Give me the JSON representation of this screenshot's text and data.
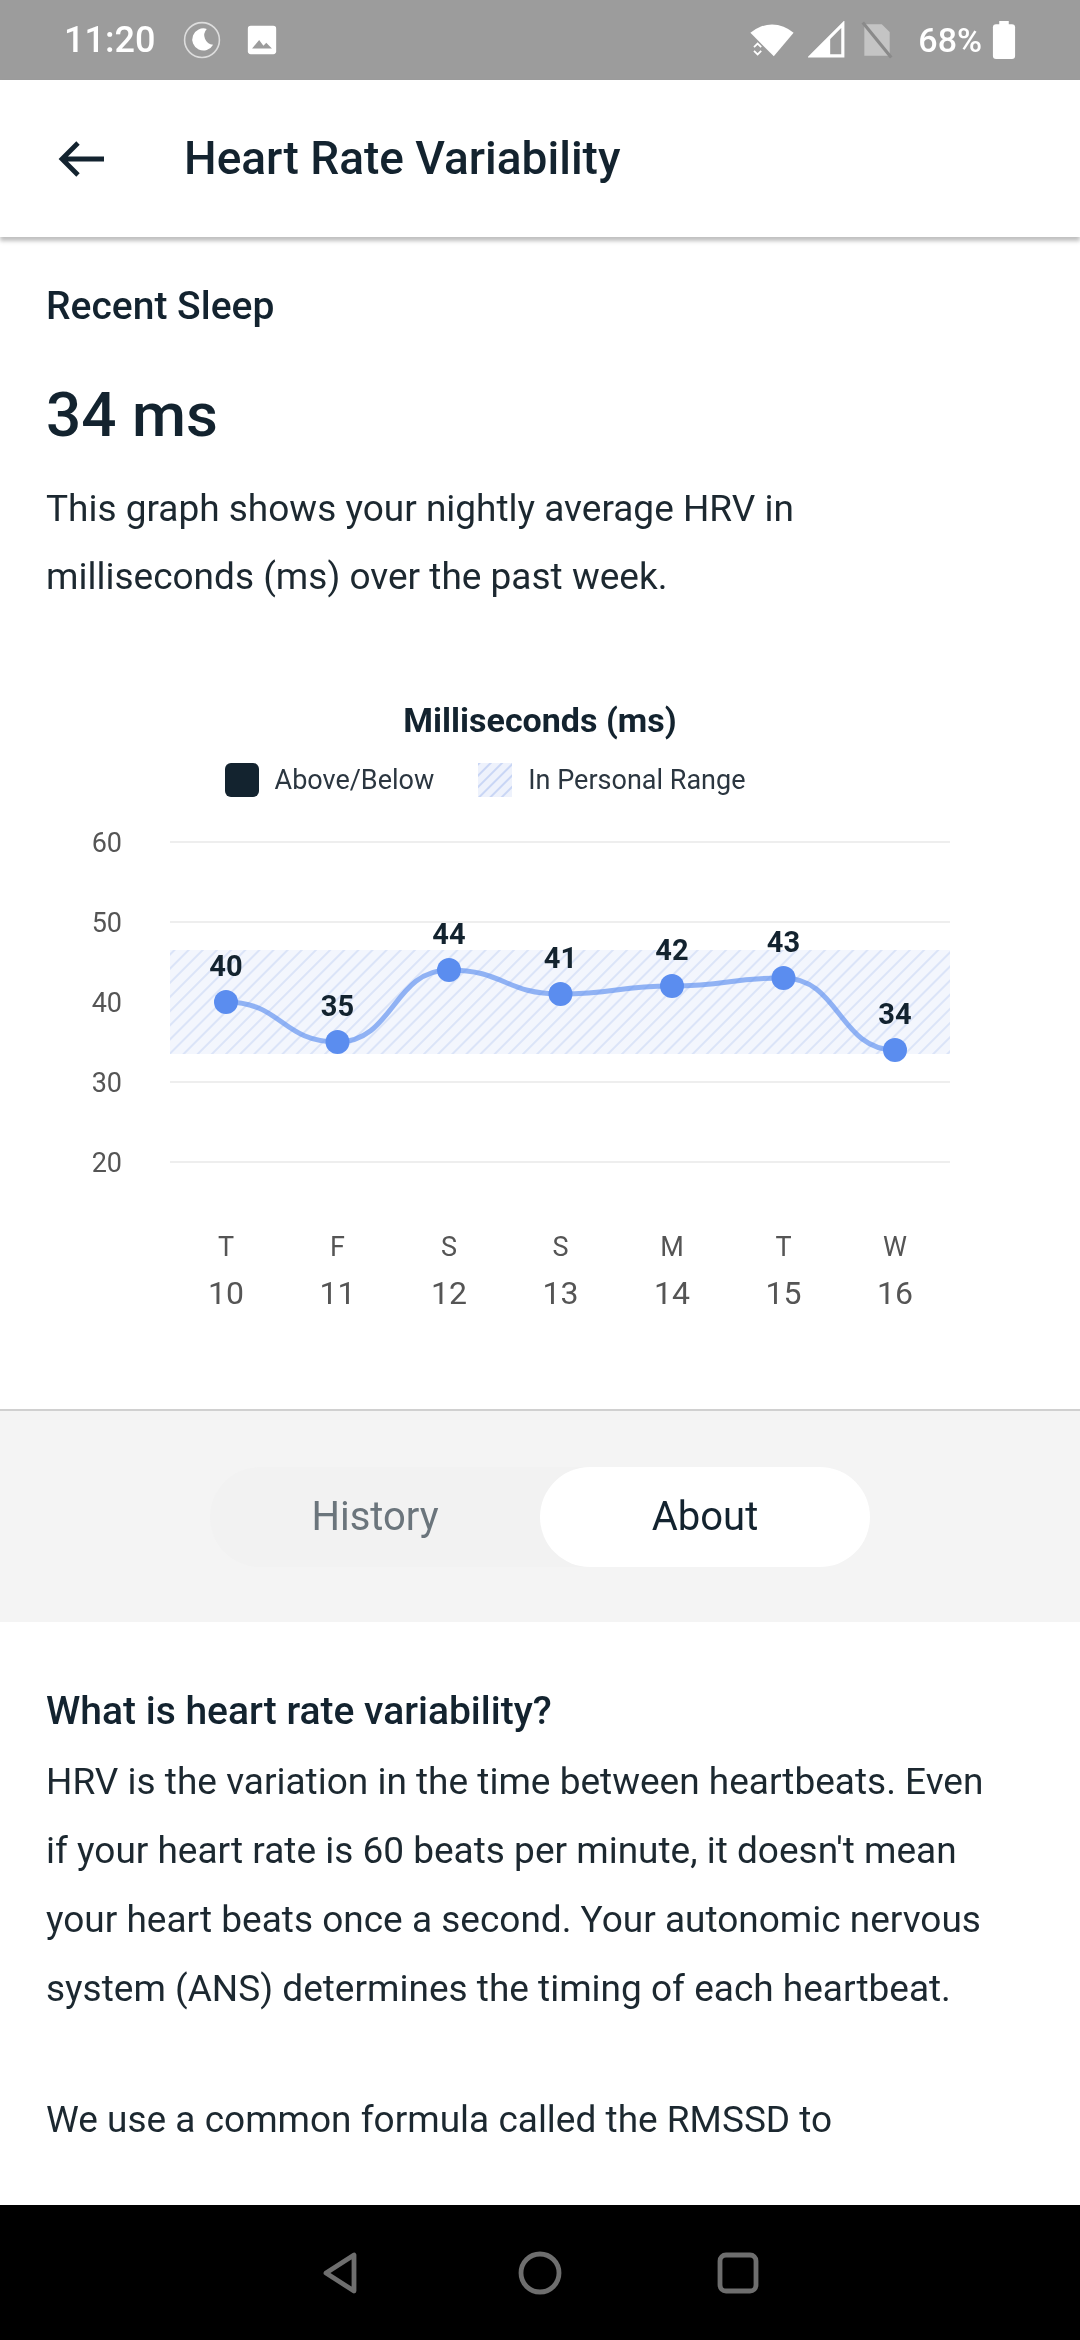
{
  "status_bar": {
    "time": "11:20",
    "battery": "68%"
  },
  "app_bar": {
    "title": "Heart Rate Variability"
  },
  "summary": {
    "label": "Recent Sleep",
    "value": "34 ms",
    "description": "This graph shows your nightly average HRV in milliseconds (ms) over the past week."
  },
  "chart": {
    "legend": [
      {
        "kind": "swatch",
        "label": "Above/Below",
        "color": "#13232f"
      },
      {
        "kind": "hatch",
        "label": "In Personal Range",
        "color": "#c9d6f5"
      }
    ],
    "day_labels": [
      "T",
      "F",
      "S",
      "S",
      "M",
      "T",
      "W"
    ],
    "chart_data": {
      "type": "line",
      "title": "Milliseconds (ms)",
      "categories": [
        "10",
        "11",
        "12",
        "13",
        "14",
        "15",
        "16"
      ],
      "series": [
        {
          "color": "#5b8def",
          "marker": "circle",
          "values": [
            40,
            35,
            44,
            41,
            42,
            43,
            34
          ]
        }
      ],
      "ylim": [
        20,
        60
      ],
      "yticks": [
        60,
        50,
        40,
        30,
        20
      ],
      "data_labels": true
    }
  },
  "tabs": [
    {
      "label": "History",
      "selected": false
    },
    {
      "label": "About",
      "selected": true
    }
  ],
  "about": {
    "heading": "What is heart rate variability?",
    "paragraphs": [
      "HRV is the variation in the time between heartbeats. Even if your heart rate is 60 beats per minute, it doesn't mean your heart beats once a second. Your autonomic nervous system (ANS) determines the timing of each heartbeat.",
      "We use a common formula called the RMSSD to"
    ]
  }
}
